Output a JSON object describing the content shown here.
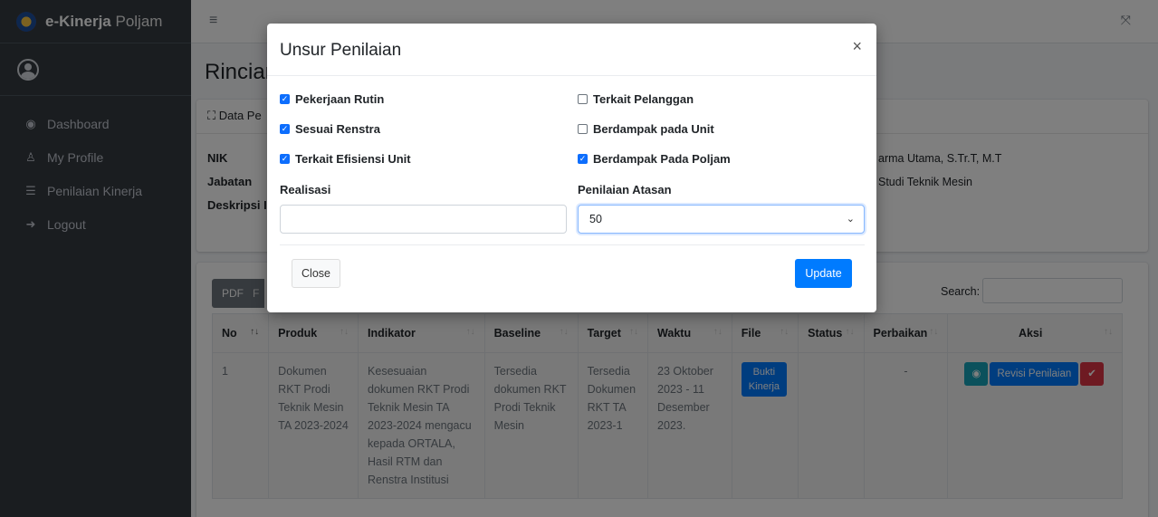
{
  "brand": {
    "name_bold": "e-Kinerja",
    "name_light": "Poljam"
  },
  "sidebar": {
    "items": [
      {
        "icon": "dashboard-icon",
        "label": "Dashboard"
      },
      {
        "icon": "user-icon",
        "label": "My Profile"
      },
      {
        "icon": "list-icon",
        "label": "Penilaian Kinerja"
      },
      {
        "icon": "logout-icon",
        "label": "Logout"
      }
    ]
  },
  "topbar": {
    "menu_icon": "≡",
    "fullscreen_icon": "⤧"
  },
  "page": {
    "title": "Rincian",
    "card_header": "Data Pe",
    "labels": {
      "nik": "NIK",
      "jabatan": "Jabatan",
      "deskripsi": "Deskripsi I"
    },
    "right_values": [
      "arma Utama, S.Tr.T, M.T",
      "Studi Teknik Mesin"
    ]
  },
  "table_card": {
    "pdf_label": "PDF",
    "extra_label": "F",
    "search_label": "Search:",
    "headers": [
      "No",
      "Produk",
      "Indikator",
      "Baseline",
      "Target",
      "Waktu",
      "File",
      "Status",
      "Perbaikan",
      "Aksi"
    ],
    "rows": [
      {
        "no": "1",
        "produk": "Dokumen RKT Prodi Teknik Mesin TA 2023-2024",
        "indikator": "Kesesuaian dokumen RKT Prodi Teknik Mesin TA 2023-2024 mengacu kepada ORTALA, Hasil RTM dan Renstra Institusi",
        "baseline": "Tersedia dokumen RKT Prodi Teknik Mesin",
        "target": "Tersedia Dokumen RKT TA 2023-1",
        "waktu": "23 Oktober 2023 - 11 Desember 2023.",
        "file_button": "Bukti Kinerja",
        "status": "",
        "perbaikan": "-",
        "revisi_button": "Revisi Penilaian"
      }
    ]
  },
  "modal": {
    "title": "Unsur Penilaian",
    "close_x": "×",
    "checkboxes": [
      {
        "label": "Pekerjaan Rutin",
        "checked": true
      },
      {
        "label": "Terkait Pelanggan",
        "checked": false
      },
      {
        "label": "Sesuai Renstra",
        "checked": true
      },
      {
        "label": "Berdampak pada Unit",
        "checked": false
      },
      {
        "label": "Terkait Efisiensi Unit",
        "checked": true
      },
      {
        "label": "Berdampak Pada Poljam",
        "checked": true
      }
    ],
    "realisasi_label": "Realisasi",
    "realisasi_value": "",
    "penilaian_label": "Penilaian Atasan",
    "penilaian_value": "50",
    "close_button": "Close",
    "update_button": "Update"
  }
}
